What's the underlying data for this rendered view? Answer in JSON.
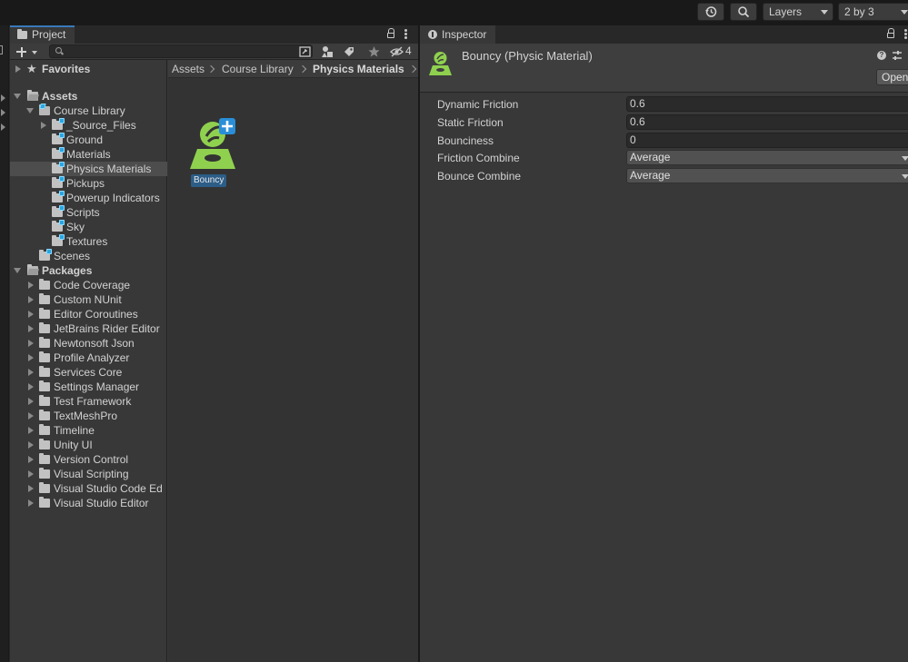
{
  "toolbar": {
    "history_icon": "history-icon",
    "search_icon": "search-icon",
    "layers_label": "Layers",
    "layout_label": "2 by 3"
  },
  "project": {
    "tab_label": "Project",
    "hidden_count": "4",
    "favorites_label": "Favorites",
    "assets_label": "Assets",
    "packages_label": "Packages",
    "course_library_label": "Course Library",
    "course_children": [
      "_Source_Files",
      "Ground",
      "Materials",
      "Physics Materials",
      "Pickups",
      "Powerup Indicators",
      "Scripts",
      "Sky",
      "Textures"
    ],
    "scenes_label": "Scenes",
    "packages": [
      "Code Coverage",
      "Custom NUnit",
      "Editor Coroutines",
      "JetBrains Rider Editor",
      "Newtonsoft Json",
      "Profile Analyzer",
      "Services Core",
      "Settings Manager",
      "Test Framework",
      "TextMeshPro",
      "Timeline",
      "Unity UI",
      "Version Control",
      "Visual Scripting",
      "Visual Studio Code Ed",
      "Visual Studio Editor"
    ],
    "breadcrumb": [
      "Assets",
      "Course Library",
      "Physics Materials"
    ],
    "asset_name": "Bouncy"
  },
  "inspector": {
    "tab_label": "Inspector",
    "title": "Bouncy (Physic Material)",
    "open_label": "Open",
    "props": {
      "dynamic_friction": {
        "label": "Dynamic Friction",
        "value": "0.6"
      },
      "static_friction": {
        "label": "Static Friction",
        "value": "0.6"
      },
      "bounciness": {
        "label": "Bounciness",
        "value": "0"
      },
      "friction_combine": {
        "label": "Friction Combine",
        "value": "Average"
      },
      "bounce_combine": {
        "label": "Bounce Combine",
        "value": "Average"
      }
    }
  },
  "colors": {
    "accent_blue": "#3a79bb",
    "selection": "#2c5d87",
    "asset_green": "#8fd14f"
  }
}
